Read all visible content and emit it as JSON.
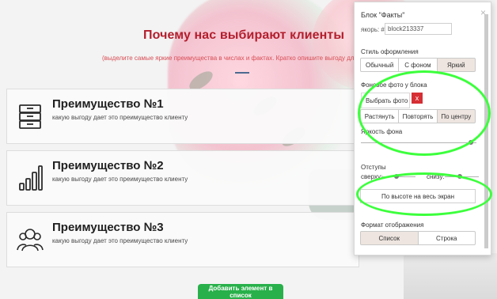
{
  "page": {
    "title": "Почему нас выбирают клиенты",
    "subtitle": "(выделите самые яркие преимущества в числах и фактах. Кратко опишите выгоду для клиента)"
  },
  "cards": [
    {
      "title": "Преимущество №1",
      "description": "какую выгоду дает это преимущество клиенту",
      "icon": "archive-drawers-icon"
    },
    {
      "title": "Преимущество №2",
      "description": "какую выгоду дает это преимущество клиенту",
      "icon": "bar-chart-icon"
    },
    {
      "title": "Преимущество №3",
      "description": "какую выгоду дает это преимущество клиенту",
      "icon": "users-group-icon"
    }
  ],
  "add_button": {
    "label": "Добавить элемент в список"
  },
  "panel": {
    "title": "Блок \"Факты\"",
    "close": "×",
    "anchor": {
      "label": "якорь: #",
      "value": "block213337"
    },
    "style": {
      "label": "Стиль оформления",
      "options": [
        "Обычный",
        "С фоном",
        "Яркий"
      ],
      "selected": "Яркий"
    },
    "background": {
      "label": "Фоновое фото у блока",
      "choose_label": "Выбрать фото",
      "delete_label": "x",
      "fit_options": [
        "Растянуть",
        "Повторять",
        "По центру"
      ],
      "fit_selected": "По центру"
    },
    "brightness": {
      "label": "Яркость фона",
      "value": 0.95
    },
    "padding": {
      "label": "Отступы",
      "top_label": "сверху:",
      "bottom_label": "снизу:",
      "top_value": 0.45,
      "bottom_value": 0.45
    },
    "fullscreen_label": "По высоте на весь экран",
    "format": {
      "label": "Формат отображения",
      "options": [
        "Список",
        "Строка"
      ],
      "selected": "Список"
    }
  },
  "colors": {
    "title": "#b31e2d",
    "subtitle": "#d84e55",
    "add_button": "#28b04a",
    "delete": "#d62f35",
    "highlight": "#3cff3c",
    "active_segment": "#eee5e0"
  }
}
